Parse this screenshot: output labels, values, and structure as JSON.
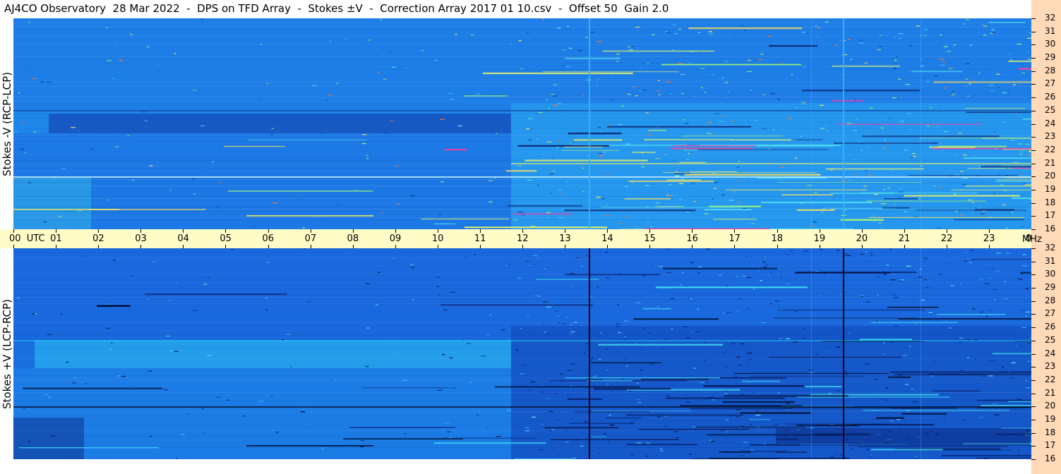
{
  "title": "AJ4CO Observatory  28 Mar 2022  -  DPS on TFD Array  -  Stokes ±V  -  Correction Array 2017 01 10.csv  -  Offset 50  Gain 2.0",
  "panels": [
    {
      "ylabel": "Stokes -V (RCP-LCP)",
      "theme": "bright"
    },
    {
      "ylabel": "Stokes +V (LCP-RCP)",
      "theme": "dark"
    }
  ],
  "time_axis": {
    "labels": [
      "00  UTC",
      "01",
      "02",
      "03",
      "04",
      "05",
      "06",
      "07",
      "08",
      "09",
      "10",
      "11",
      "12",
      "13",
      "14",
      "15",
      "16",
      "17",
      "18",
      "19",
      "20",
      "21",
      "22",
      "23",
      "00"
    ],
    "unit": "MHz"
  },
  "freq_axis": {
    "labels": [
      "32",
      "31",
      "30",
      "29",
      "28",
      "27",
      "26",
      "25",
      "24",
      "23",
      "22",
      "21",
      "20",
      "19",
      "18",
      "17",
      "16"
    ]
  },
  "colors": {
    "time_axis_bg": "#fffcc8",
    "freq_axis_bg": "#ffd9b8",
    "spectrogram_base": "#1c82e8"
  }
}
